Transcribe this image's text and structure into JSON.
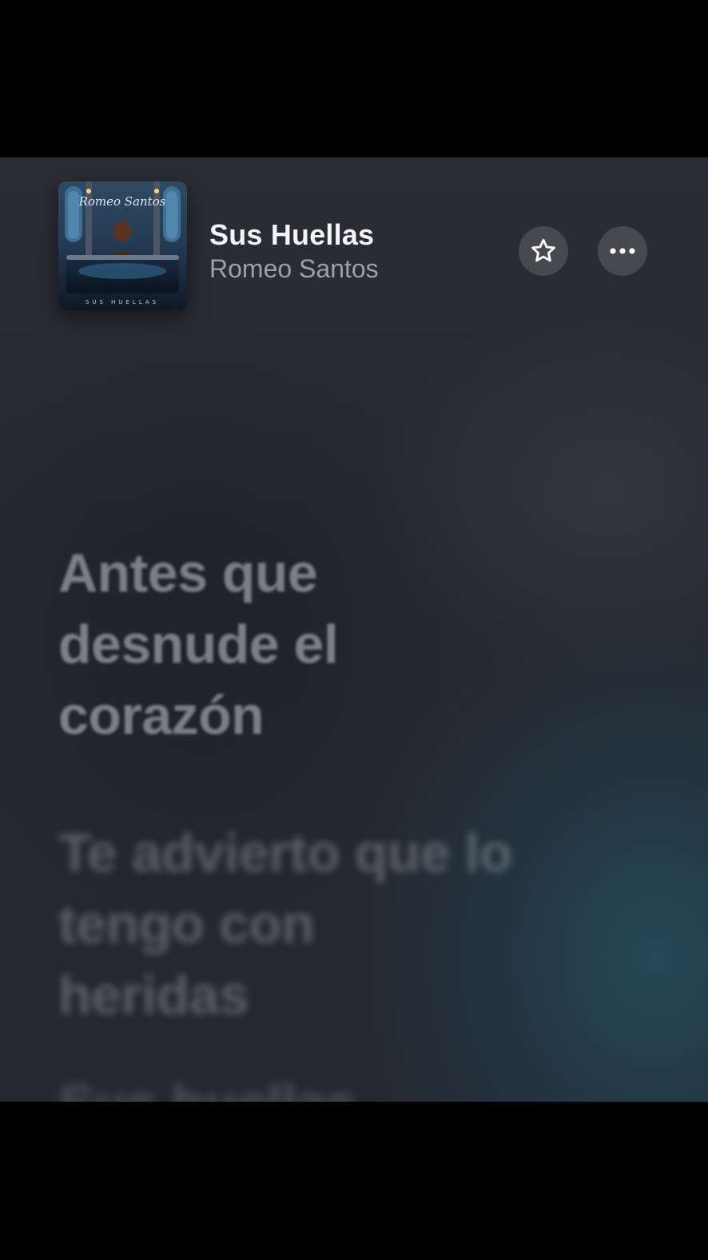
{
  "now_playing": {
    "title": "Sus Huellas",
    "artist": "Romeo Santos",
    "album_art": {
      "artist_script": "Romeo Santos",
      "album_caption": "SUS HUELLAS"
    },
    "favorite_icon": "star-outline-icon",
    "more_icon": "ellipsis-icon"
  },
  "lyrics": {
    "lines": [
      "Antes que\ndesnude el\ncorazón",
      "Te advierto que lo\ntengo con\nheridas",
      "Sus huellas"
    ]
  },
  "colors": {
    "background": "#25272e",
    "accent_teal": "#264e60",
    "title_text": "#f4f4f6",
    "artist_text": "#9da0a8"
  }
}
